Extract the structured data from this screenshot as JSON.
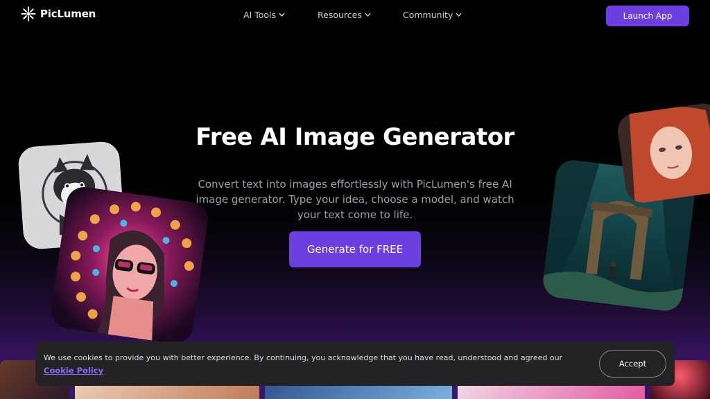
{
  "brand": {
    "name": "PicLumen",
    "accent": "#6b3fe0",
    "link_color": "#8f66ff"
  },
  "nav": {
    "items": [
      {
        "label": "AI Tools"
      },
      {
        "label": "Resources"
      },
      {
        "label": "Community"
      }
    ],
    "launch_label": "Launch App"
  },
  "hero": {
    "title": "Free AI Image Generator",
    "subtitle": "Convert text into images effortlessly with PicLumen's free AI image generator. Type your idea, choose a model, and watch your text come to life.",
    "cta_label": "Generate for FREE"
  },
  "cookie": {
    "text": "We use cookies to provide you with better experience. By continuing, you acknowledge that you have read, understood and agreed our",
    "link_label": "Cookie Policy",
    "accept_label": "Accept"
  },
  "icons": [
    "piclumen-logo-icon",
    "chevron-down-icon"
  ]
}
